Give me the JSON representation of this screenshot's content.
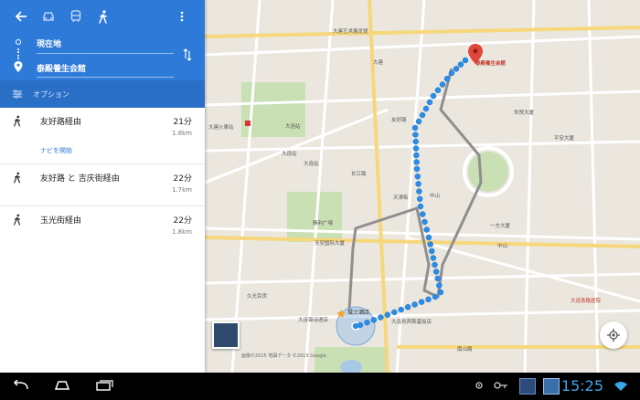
{
  "header": {
    "origin": "現在地",
    "destination": "泰殿養生会館",
    "options_label": "オプション"
  },
  "routes": [
    {
      "name": "友好路経由",
      "time": "21分",
      "distance": "1.8km",
      "nav": "ナビを開始"
    },
    {
      "name": "友好路 と 吉庆街経由",
      "time": "22分",
      "distance": "1.7km"
    },
    {
      "name": "玉光街経由",
      "time": "22分",
      "distance": "1.8km"
    }
  ],
  "map": {
    "destination_label": "泰殿養生会館",
    "hotel_label": "城士酒店",
    "labels": {
      "dalian": "大連",
      "dalian_art": "大連艺术展览馆",
      "dalian_station": "大連火車站",
      "dalian_zhan": "大连站",
      "dalian_zhan2": "大连站",
      "dalian_zhan3": "大连站",
      "tianan": "天安国际大厦",
      "shengli": "勝利广場",
      "yifang": "一方大厦",
      "shijie": "世贸大厦",
      "pingan": "平安大厦",
      "kaibin": "大连凯宾斯基饭店",
      "railway_hospital": "大连铁路医院",
      "jiuguang": "久光百货",
      "zhongshan": "中山",
      "zhongshan2": "中山",
      "nanshan": "南山路",
      "luxun": "鲁迅路",
      "youhao": "友好路",
      "changjiang": "长江路",
      "tianjin": "天津街",
      "pig": "大连锦诗酒店"
    },
    "copyright": "画像©2015 地図データ ©2015 Google"
  },
  "system": {
    "time": "15:25"
  },
  "colors": {
    "header": "#2e7ad9",
    "options_bar": "#2a6fc6",
    "route_dot": "#2b8de8",
    "alt_route": "#8f8f8f",
    "pin": "#e0463a",
    "clock": "#3aa7e8"
  }
}
